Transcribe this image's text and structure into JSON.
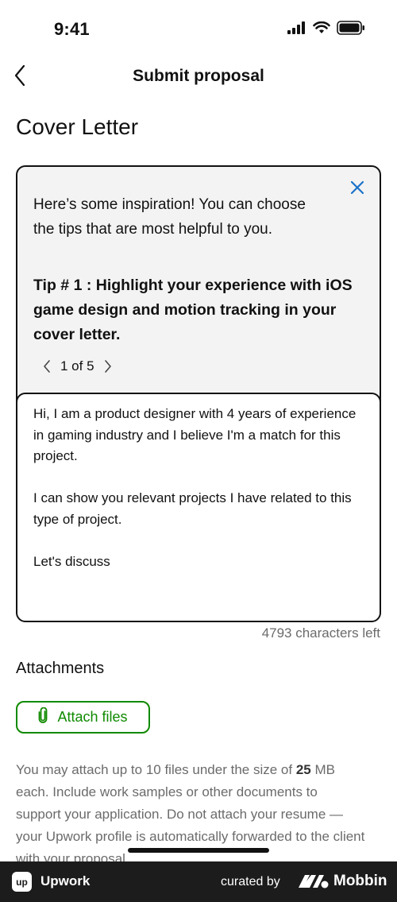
{
  "status_bar": {
    "time": "9:41",
    "icons": [
      "signal-icon",
      "wifi-icon",
      "battery-icon"
    ]
  },
  "nav": {
    "back_icon": "chevron-left-icon",
    "title": "Submit proposal"
  },
  "page": {
    "title": "Cover Letter"
  },
  "tips": {
    "close_icon": "close-icon",
    "intro": "Here’s some inspiration! You can choose the tips that are most helpful to you.",
    "tip": "Tip # 1 : Highlight your experience with iOS game design and motion tracking in your cover letter.",
    "pager": {
      "prev_icon": "chevron-left-icon",
      "label": "1 of 5",
      "next_icon": "chevron-right-icon"
    }
  },
  "cover_letter": {
    "paragraphs": [
      "Hi, I am a product designer with 4 years of experience in gaming industry and I believe I'm a match for this project.",
      "I can show you relevant projects I have related to this type of project.",
      "Let's discuss"
    ],
    "chars_left": "4793 characters left"
  },
  "attachments": {
    "title": "Attachments",
    "button_label": "Attach files",
    "button_icon": "paperclip-icon",
    "note_before": "You may attach up to 10 files under the size of ",
    "note_size": "25",
    "note_after": " MB each. Include work samples or other documents to support your application. Do not attach your resume — your Upwork profile is automatically forwarded to the client with your proposal."
  },
  "footer": {
    "brand_logo_text": "up",
    "brand": "Upwork",
    "curated_by": "curated by",
    "mobbin": "Mobbin"
  },
  "colors": {
    "accent_green": "#108a00",
    "link_blue": "#1a73c8",
    "card_bg": "#f3f3f3",
    "footer_bg": "#1c1c1c"
  }
}
